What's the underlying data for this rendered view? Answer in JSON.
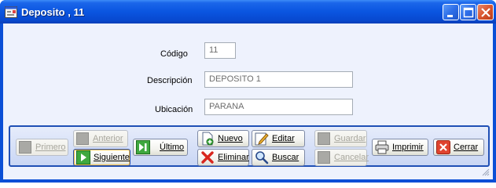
{
  "window": {
    "title": "Deposito , 11"
  },
  "form": {
    "codigo_label": "Código",
    "codigo_value": "11",
    "descripcion_label": "Descripción",
    "descripcion_value": "DEPOSITO 1",
    "ubicacion_label": "Ubicación",
    "ubicacion_value": "PARANA"
  },
  "toolbar": {
    "primero": "Primero",
    "anterior": "Anterior",
    "siguiente": "Siguiente",
    "ultimo": "Último",
    "nuevo": "Nuevo",
    "editar": "Editar",
    "eliminar": "Eliminar",
    "buscar": "Buscar",
    "guardar": "Guardar",
    "cancelar": "Cancelar",
    "imprimir": "Imprimir",
    "cerrar": "Cerrar"
  },
  "icons": {
    "app": "window-form-icon",
    "minimize": "minimize-icon",
    "maximize": "maximize-icon",
    "close": "close-icon",
    "siguiente": "play-next-icon",
    "ultimo": "skip-last-icon",
    "nuevo": "new-document-icon",
    "editar": "edit-pencil-icon",
    "eliminar": "red-x-icon",
    "buscar": "magnifier-icon",
    "imprimir": "printer-icon",
    "cerrar": "close-box-icon"
  },
  "colors": {
    "titlebar": "#0a55e0",
    "client": "#eef2fd",
    "toolbar_border": "#1f4fb5",
    "close_button": "#d9552e"
  }
}
